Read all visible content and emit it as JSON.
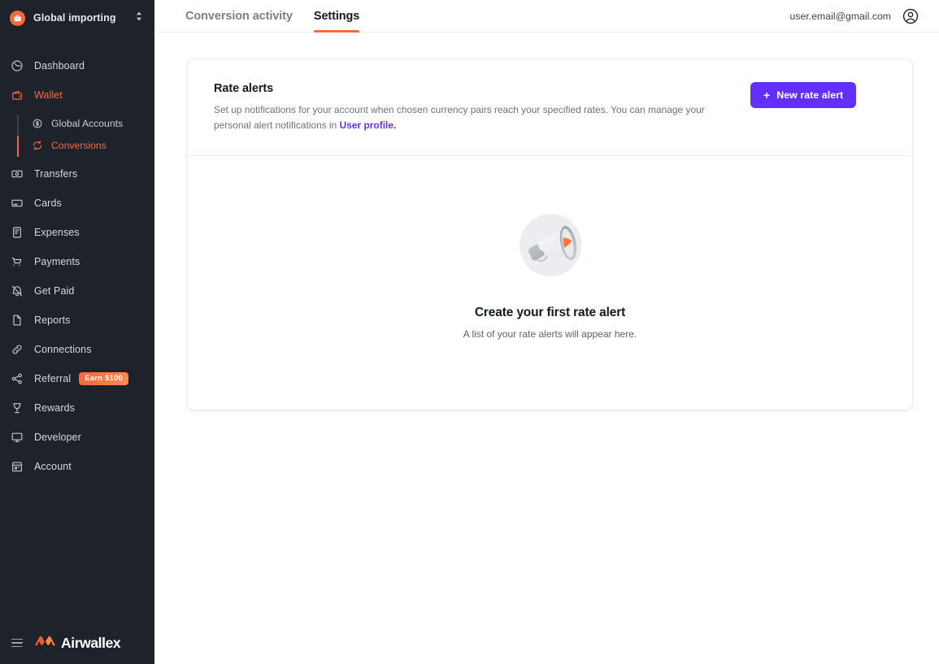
{
  "sidebar": {
    "org": {
      "name": "Global importing",
      "avatar_icon": "briefcase-icon",
      "switcher_icon": "chevron-up-down-icon"
    },
    "items": [
      {
        "label": "Dashboard",
        "icon": "dashboard-icon",
        "active": false
      },
      {
        "label": "Wallet",
        "icon": "wallet-icon",
        "active": true
      },
      {
        "label": "Transfers",
        "icon": "transfers-icon",
        "active": false
      },
      {
        "label": "Cards",
        "icon": "cards-icon",
        "active": false
      },
      {
        "label": "Expenses",
        "icon": "expenses-icon",
        "active": false
      },
      {
        "label": "Payments",
        "icon": "cart-icon",
        "active": false
      },
      {
        "label": "Get Paid",
        "icon": "get-paid-icon",
        "active": false
      },
      {
        "label": "Reports",
        "icon": "reports-icon",
        "active": false
      },
      {
        "label": "Connections",
        "icon": "link-icon",
        "active": false
      },
      {
        "label": "Referral",
        "icon": "share-icon",
        "active": false,
        "badge": "Earn $100"
      },
      {
        "label": "Rewards",
        "icon": "trophy-icon",
        "active": false
      },
      {
        "label": "Developer",
        "icon": "monitor-icon",
        "active": false
      },
      {
        "label": "Account",
        "icon": "storefront-icon",
        "active": false
      }
    ],
    "subitems": [
      {
        "label": "Global Accounts",
        "icon": "dollar-circle-icon",
        "active": false
      },
      {
        "label": "Conversions",
        "icon": "refresh-currency-icon",
        "active": true
      }
    ],
    "footer": {
      "menu_icon": "hamburger-icon",
      "brand": "Airwallex",
      "brand_mark_icon": "airwallex-logo-icon"
    }
  },
  "topbar": {
    "tabs": [
      {
        "label": "Conversion activity",
        "active": false
      },
      {
        "label": "Settings",
        "active": true
      }
    ],
    "user_email": "user.email@gmail.com",
    "avatar_icon": "user-circle-icon"
  },
  "card": {
    "title": "Rate alerts",
    "description_prefix": "Set up notifications for your account when chosen currency pairs reach your specified rates. You can manage your personal alert notifications in ",
    "description_link": "User profile.",
    "primary_button": {
      "label": "New rate alert",
      "icon": "plus-icon"
    }
  },
  "empty_state": {
    "illustration_icon": "megaphone-illustration",
    "title": "Create your first rate alert",
    "subtitle": "A list of your rate alerts will appear here."
  },
  "colors": {
    "sidebar_bg": "#1E232B",
    "brand_orange": "#F5693B",
    "accent_purple": "#612FFF",
    "text_primary": "#16191F",
    "text_muted": "#6D737D",
    "card_border": "#EDEEF1"
  }
}
